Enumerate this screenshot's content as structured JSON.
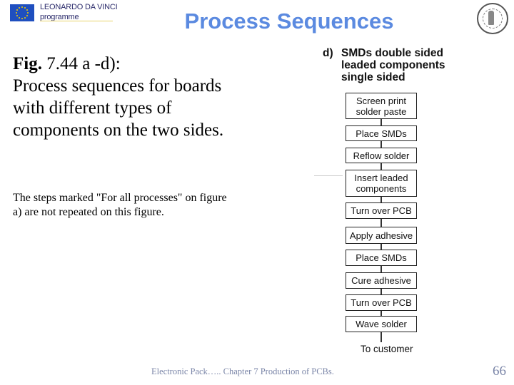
{
  "header": {
    "logo": {
      "icon": "eu-flag-icon",
      "line1": "LEONARDO DA VINCI",
      "line2": "programme"
    },
    "title": "Process Sequences",
    "seal_icon": "university-seal-icon"
  },
  "caption": {
    "fig_label": "Fig.",
    "fig_rest": " 7.44 a -d):",
    "body": "Process sequences for boards with different types of components on the two sides."
  },
  "note": "The steps marked \"For all processes\" on figure a) are not repeated on this figure.",
  "diagram": {
    "label": "d)",
    "heading_lines": [
      "SMDs double sided",
      "leaded components",
      "single sided"
    ],
    "steps": [
      {
        "line1": "Screen print",
        "line2": "solder paste"
      },
      {
        "line1": "Place SMDs",
        "line2": ""
      },
      {
        "line1": "Reflow solder",
        "line2": ""
      },
      {
        "line1": "Insert leaded",
        "line2": "components"
      },
      {
        "line1": "Turn over PCB",
        "line2": ""
      },
      {
        "line1": "Apply adhesive",
        "line2": ""
      },
      {
        "line1": "Place SMDs",
        "line2": ""
      },
      {
        "line1": "Cure adhesive",
        "line2": ""
      },
      {
        "line1": "Turn over PCB",
        "line2": ""
      },
      {
        "line1": "Wave solder",
        "line2": ""
      }
    ],
    "end_label": "To customer"
  },
  "footer": {
    "text": "Electronic Pack….. Chapter 7 Production of PCBs.",
    "page_number": "66"
  },
  "colors": {
    "title": "#5b8ae0",
    "footer": "#7b86a8",
    "eu_blue": "#1f4fbf",
    "eu_star": "#f4d000"
  }
}
